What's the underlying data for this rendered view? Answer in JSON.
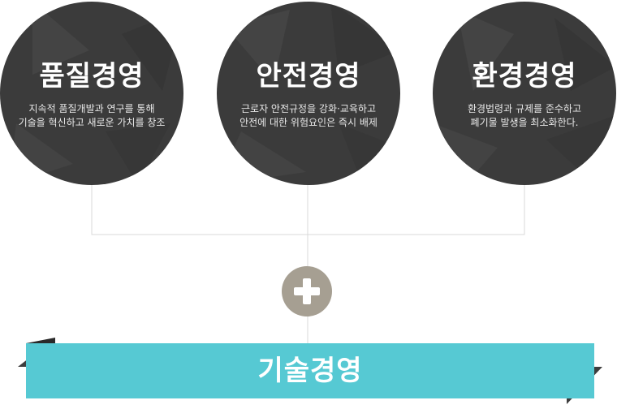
{
  "pillars": [
    {
      "title": "품질경영",
      "description": "지속적 품질개발과 연구를 통해\n기술을 혁신하고 새로운 가치를 창조"
    },
    {
      "title": "안전경영",
      "description": "근로자 안전규정을 강화·교육하고\n안전에 대한 위험요인은 즉시 배제"
    },
    {
      "title": "환경경영",
      "description": "환경법령과 규제를 준수하고\n폐기물 발생을 최소화한다."
    }
  ],
  "plus_icon": "plus-icon",
  "foundation": {
    "label": "기술경영"
  },
  "colors": {
    "circle": "#3b3b3b",
    "plus_badge": "#a69f92",
    "foundation_bar": "#56c9d3",
    "connector": "#d9d9d9"
  }
}
